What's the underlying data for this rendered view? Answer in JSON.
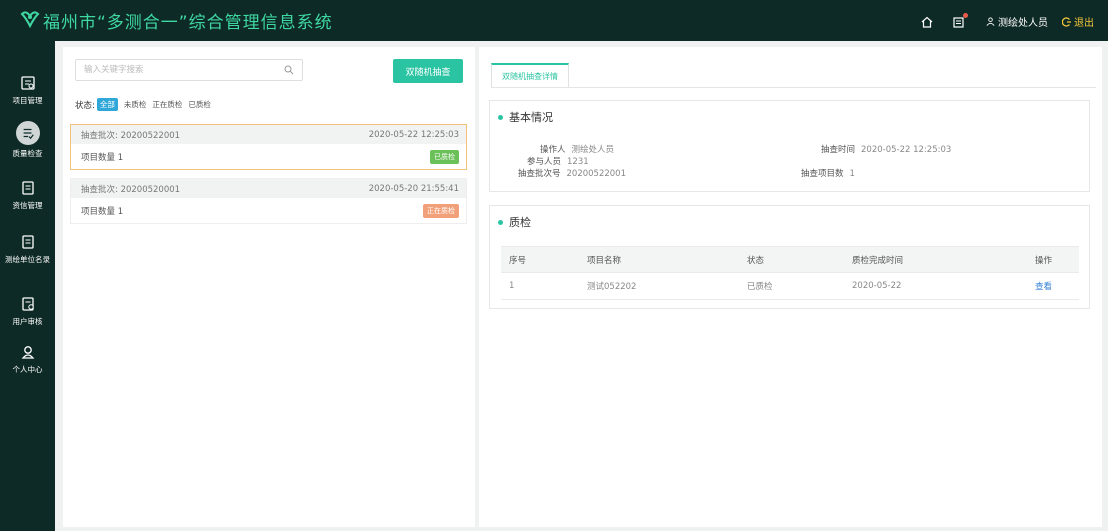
{
  "header": {
    "title": "福州市“多测合一”综合管理信息系统",
    "user_name": "测绘处人员",
    "logout_label": "退出",
    "accent_color": "#3fd8a2",
    "logout_color": "#f4c83a"
  },
  "sidebar": {
    "items": [
      {
        "label": "项目管理",
        "icon": "project-icon"
      },
      {
        "label": "质量检查",
        "icon": "checklist-icon",
        "active": true
      },
      {
        "label": "资信管理",
        "icon": "document-icon"
      },
      {
        "label": "测绘单位名录",
        "icon": "document-icon"
      },
      {
        "label": "用户审核",
        "icon": "user-audit-icon"
      },
      {
        "label": "个人中心",
        "icon": "user-icon"
      }
    ]
  },
  "left": {
    "search_placeholder": "输入关键字搜索",
    "random_check_button": "双随机抽查",
    "status_label": "状态:",
    "filters": [
      "全部",
      "未质检",
      "正在质检",
      "已质检"
    ],
    "cards": [
      {
        "batch": "抽查批次: 20200522001",
        "time": "2020-05-22 12:25:03",
        "count": "项目数量 1",
        "status": "已质检",
        "status_color": "#6cc05a"
      },
      {
        "batch": "抽查批次: 20200520001",
        "time": "2020-05-20 21:55:41",
        "count": "项目数量 1",
        "status": "正在质检",
        "status_color": "#f2a07a"
      }
    ]
  },
  "right": {
    "tab_label": "双随机抽查详情",
    "basic": {
      "title": "基本情况",
      "operator_label": "操作人",
      "operator_value": "测绘处人员",
      "participants_label": "参与人员",
      "participants_value": "1231",
      "batch_label": "抽查批次号",
      "batch_value": "20200522001",
      "check_time_label": "抽查时间",
      "check_time_value": "2020-05-22 12:25:03",
      "project_count_label": "抽查项目数",
      "project_count_value": "1"
    },
    "quality": {
      "title": "质检",
      "columns": [
        "序号",
        "项目名称",
        "状态",
        "质检完成时间",
        "操作"
      ],
      "rows": [
        {
          "no": "1",
          "name": "测试052202",
          "status": "已质检",
          "time": "2020-05-22",
          "action": "查看"
        }
      ]
    }
  }
}
